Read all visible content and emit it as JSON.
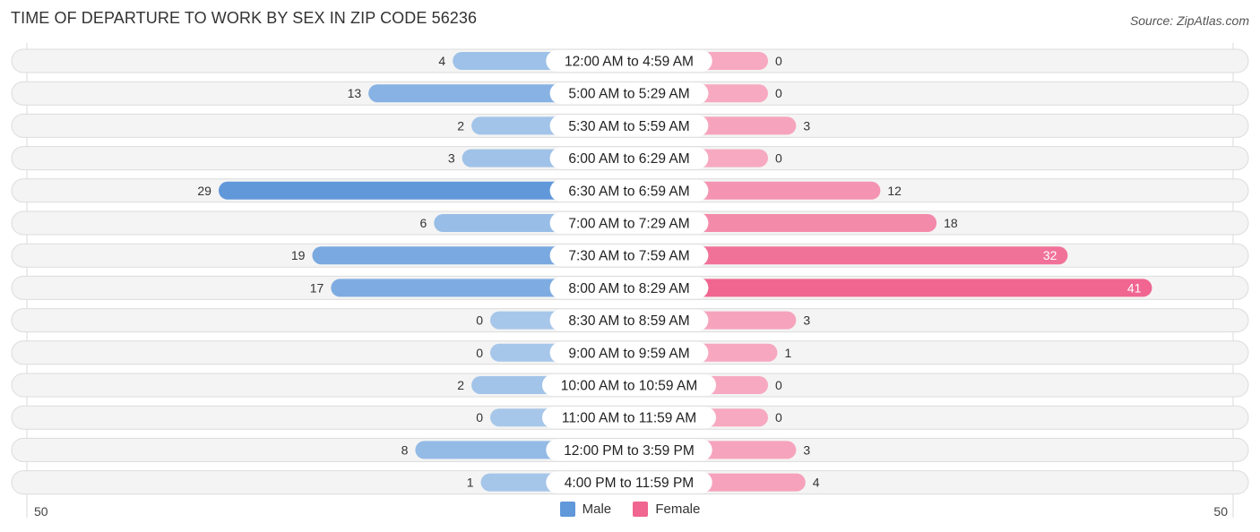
{
  "header": {
    "title": "TIME OF DEPARTURE TO WORK BY SEX IN ZIP CODE 56236",
    "source": "Source: ZipAtlas.com"
  },
  "colors": {
    "male_light": "#a7c7ea",
    "male_dark": "#6098da",
    "female_light": "#f7a9c1",
    "female_dark": "#f06690",
    "row_bg": "#f3f3f3"
  },
  "chart_data": {
    "type": "bar",
    "orientation": "horizontal-diverging",
    "title": "TIME OF DEPARTURE TO WORK BY SEX IN ZIP CODE 56236",
    "categories": [
      "12:00 AM to 4:59 AM",
      "5:00 AM to 5:29 AM",
      "5:30 AM to 5:59 AM",
      "6:00 AM to 6:29 AM",
      "6:30 AM to 6:59 AM",
      "7:00 AM to 7:29 AM",
      "7:30 AM to 7:59 AM",
      "8:00 AM to 8:29 AM",
      "8:30 AM to 8:59 AM",
      "9:00 AM to 9:59 AM",
      "10:00 AM to 10:59 AM",
      "11:00 AM to 11:59 AM",
      "12:00 PM to 3:59 PM",
      "4:00 PM to 11:59 PM"
    ],
    "series": [
      {
        "name": "Male",
        "values": [
          4,
          13,
          2,
          3,
          29,
          6,
          19,
          17,
          0,
          0,
          2,
          0,
          8,
          1
        ]
      },
      {
        "name": "Female",
        "values": [
          0,
          0,
          3,
          0,
          12,
          18,
          32,
          41,
          3,
          1,
          0,
          0,
          3,
          4
        ]
      }
    ],
    "axis_min_label": "50",
    "axis_max_label": "50",
    "xlim": [
      -50,
      50
    ],
    "legend": [
      "Male",
      "Female"
    ],
    "legend_position": "bottom-center"
  }
}
